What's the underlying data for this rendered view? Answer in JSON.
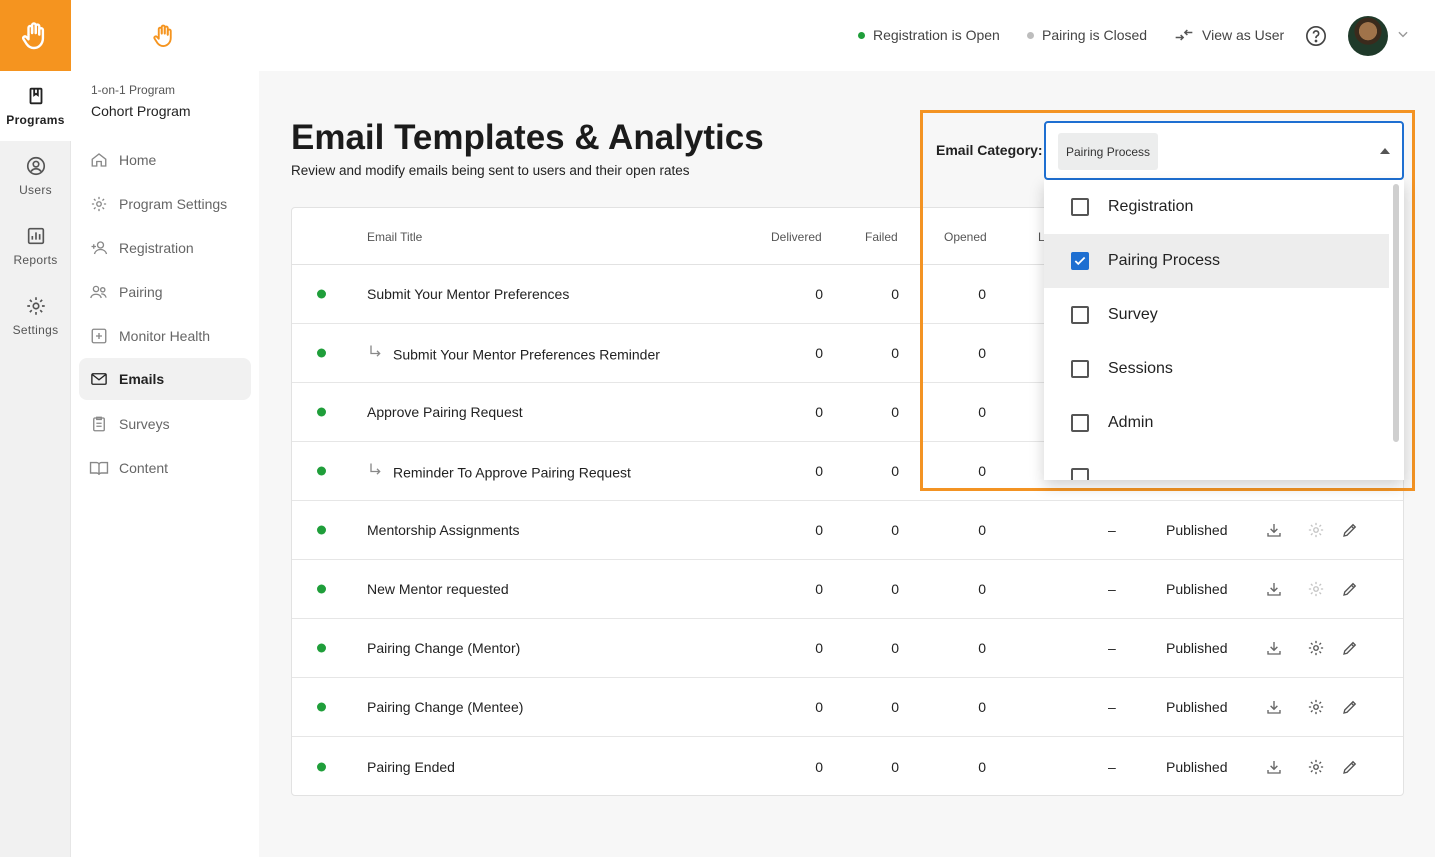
{
  "rail": {
    "items": [
      {
        "label": "Programs",
        "icon": "book-icon",
        "active": true
      },
      {
        "label": "Users",
        "icon": "user-circle-icon",
        "active": false
      },
      {
        "label": "Reports",
        "icon": "chart-icon",
        "active": false
      },
      {
        "label": "Settings",
        "icon": "gear-icon",
        "active": false
      }
    ]
  },
  "sidebar": {
    "program_type": "1-on-1 Program",
    "program_name": "Cohort Program",
    "items": [
      {
        "label": "Home",
        "icon": "home-icon"
      },
      {
        "label": "Program Settings",
        "icon": "gear-icon"
      },
      {
        "label": "Registration",
        "icon": "add-user-icon"
      },
      {
        "label": "Pairing",
        "icon": "people-icon"
      },
      {
        "label": "Monitor Health",
        "icon": "plus-box-icon"
      },
      {
        "label": "Emails",
        "icon": "mail-icon",
        "active": true
      },
      {
        "label": "Surveys",
        "icon": "clipboard-icon"
      },
      {
        "label": "Content",
        "icon": "open-book-icon"
      }
    ]
  },
  "header": {
    "registration_status": "Registration is Open",
    "pairing_status": "Pairing is Closed",
    "view_as_user": "View as User",
    "registration_color": "#1f9e3a",
    "pairing_color": "#bdbdbd"
  },
  "page": {
    "title": "Email Templates & Analytics",
    "subtitle": "Review and modify emails being sent to users and their open rates"
  },
  "table": {
    "headers": {
      "email_title": "Email Title",
      "delivered": "Delivered",
      "failed": "Failed",
      "opened": "Opened",
      "last_partial": "L"
    },
    "rows": [
      {
        "title": "Submit Your Mentor Preferences",
        "reminder": false,
        "delivered": "0",
        "failed": "0",
        "opened": "0",
        "last": "",
        "status": ""
      },
      {
        "title": "Submit Your Mentor Preferences Reminder",
        "reminder": true,
        "delivered": "0",
        "failed": "0",
        "opened": "0",
        "last": "",
        "status": ""
      },
      {
        "title": "Approve Pairing Request",
        "reminder": false,
        "delivered": "0",
        "failed": "0",
        "opened": "0",
        "last": "",
        "status": ""
      },
      {
        "title": "Reminder To Approve Pairing Request",
        "reminder": true,
        "delivered": "0",
        "failed": "0",
        "opened": "0",
        "last": "",
        "status": ""
      },
      {
        "title": "Mentorship Assignments",
        "reminder": false,
        "delivered": "0",
        "failed": "0",
        "opened": "0",
        "last": "–",
        "status": "Published",
        "gear_muted": true
      },
      {
        "title": "New Mentor requested",
        "reminder": false,
        "delivered": "0",
        "failed": "0",
        "opened": "0",
        "last": "–",
        "status": "Published",
        "gear_muted": true
      },
      {
        "title": "Pairing Change (Mentor)",
        "reminder": false,
        "delivered": "0",
        "failed": "0",
        "opened": "0",
        "last": "–",
        "status": "Published",
        "gear_muted": false
      },
      {
        "title": "Pairing Change (Mentee)",
        "reminder": false,
        "delivered": "0",
        "failed": "0",
        "opened": "0",
        "last": "–",
        "status": "Published",
        "gear_muted": false
      },
      {
        "title": "Pairing Ended",
        "reminder": false,
        "delivered": "0",
        "failed": "0",
        "opened": "0",
        "last": "–",
        "status": "Published",
        "gear_muted": false
      }
    ]
  },
  "category_filter": {
    "label": "Email Category:",
    "selected_chip": "Pairing Process",
    "options": [
      {
        "label": "Registration",
        "checked": false
      },
      {
        "label": "Pairing Process",
        "checked": true
      },
      {
        "label": "Survey",
        "checked": false
      },
      {
        "label": "Sessions",
        "checked": false
      },
      {
        "label": "Admin",
        "checked": false
      }
    ]
  }
}
